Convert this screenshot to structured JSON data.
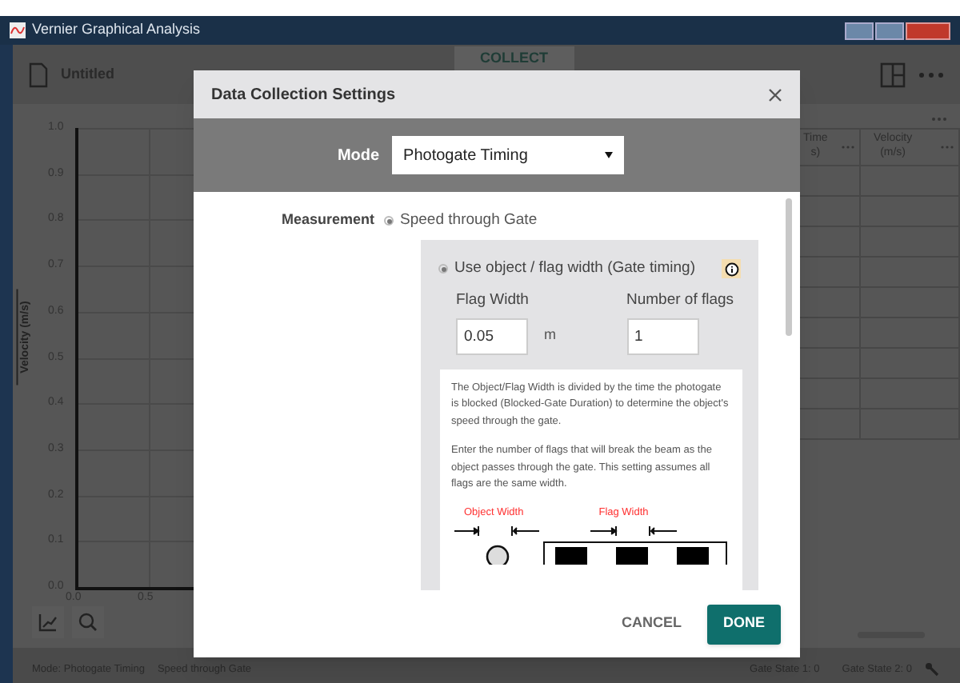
{
  "window": {
    "title": "Vernier Graphical Analysis"
  },
  "toolbar": {
    "file_name": "Untitled",
    "collect_button": "COLLECT"
  },
  "graph": {
    "y_axis_label": "Velocity (m/s)",
    "y_ticks": [
      "1.0",
      "0.9",
      "0.8",
      "0.7",
      "0.6",
      "0.5",
      "0.4",
      "0.3",
      "0.2",
      "0.1",
      "0.0"
    ],
    "x_ticks": [
      "0.0",
      "0.5"
    ]
  },
  "table": {
    "columns": [
      {
        "label": "Time\ns)"
      },
      {
        "label": "Velocity\n(m/s)"
      }
    ]
  },
  "status_bar": {
    "mode": "Mode: Photogate Timing",
    "measurement": "Speed through Gate",
    "gate_states": [
      "Gate State 1: 0",
      "Gate State 2: 0"
    ]
  },
  "dialog": {
    "title": "Data Collection Settings",
    "mode_label": "Mode",
    "mode_value": "Photogate Timing",
    "measurement_label": "Measurement",
    "measurements": [
      {
        "label": "Speed through Gate",
        "selected": true
      }
    ],
    "options": [
      {
        "label": "Use object / flag width (Gate timing)",
        "selected": true
      }
    ],
    "fields": [
      {
        "label": "Flag Width",
        "value": "0.05",
        "unit": "m"
      },
      {
        "label": "Number of flags",
        "value": "1"
      }
    ],
    "help": [
      "The Object/Flag Width is divided by the time the photogate is blocked (Blocked-Gate Duration) to determine the object's speed through the gate.",
      "Enter the number of flags that will break the beam as the object passes through the gate. This setting assumes all flags are the same width."
    ],
    "diagram_labels": [
      "Object Width",
      "Flag Width"
    ],
    "buttons": [
      {
        "label": "CANCEL",
        "kind": "text"
      },
      {
        "label": "DONE",
        "kind": "primary"
      }
    ]
  }
}
